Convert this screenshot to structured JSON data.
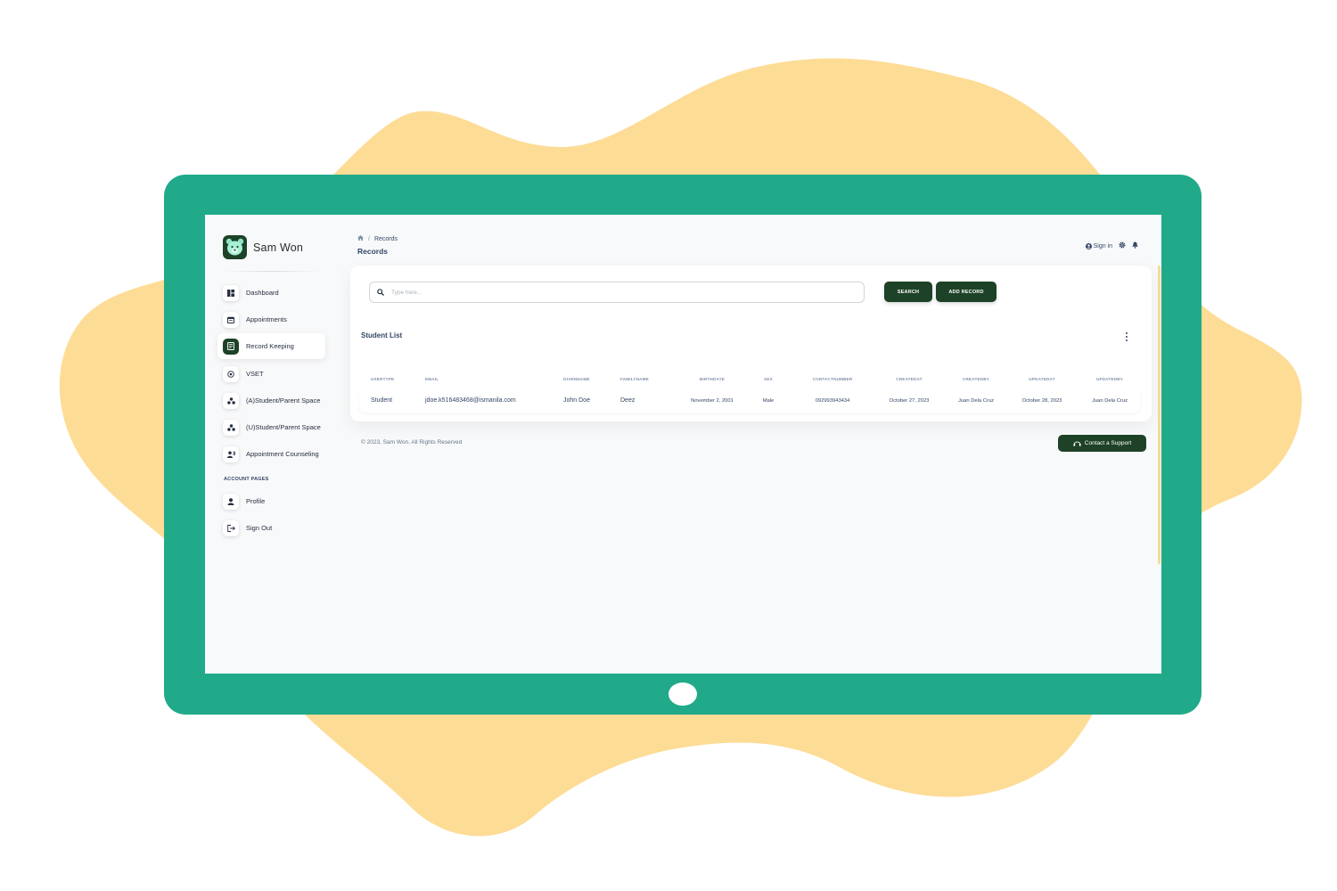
{
  "colors": {
    "frame": "#20aa89",
    "dark": "#1d4227",
    "blob": "#fddc96"
  },
  "brand": {
    "name": "Sam Won"
  },
  "sidebar": {
    "items": [
      {
        "label": "Dashboard",
        "icon": "dashboard-icon"
      },
      {
        "label": "Appointments",
        "icon": "calendar-icon"
      },
      {
        "label": "Record Keeping",
        "icon": "record-book-icon",
        "active": true
      },
      {
        "label": "VSET",
        "icon": "target-icon"
      },
      {
        "label": "(A)Student/Parent Space",
        "icon": "group-icon"
      },
      {
        "label": "(U)Student/Parent Space",
        "icon": "group-icon"
      },
      {
        "label": "Appointment Counseling",
        "icon": "counseling-icon"
      }
    ],
    "section_title": "ACCOUNT PAGES",
    "account_items": [
      {
        "label": "Profile",
        "icon": "person-icon"
      },
      {
        "label": "Sign Out",
        "icon": "sign-out-icon"
      }
    ]
  },
  "header": {
    "breadcrumb": [
      "Records"
    ],
    "title": "Records",
    "sign_in": "Sign in"
  },
  "search": {
    "placeholder": "Type here...",
    "value": ""
  },
  "buttons": {
    "search": "SEARCH",
    "add_record": "ADD RECORD"
  },
  "table": {
    "title": "Student List",
    "columns": [
      "USERTYPE",
      "EMAIL",
      "GIVENNAME",
      "FAMILYNAME",
      "BIRTHDATE",
      "SEX",
      "CONTACTNUMBER",
      "CREATEDAT",
      "CREATEDBY",
      "UPDATEDAT",
      "UPDATEDBY"
    ],
    "rows": [
      [
        "Student",
        "jdoe.k516483468@ismanila.com",
        "John Doe",
        "Deez",
        "November 2, 2001",
        "Male",
        "092993943434",
        "October 27, 2023",
        "Juan Dela Cruz",
        "October 28, 2023",
        "Juan Dela Cruz"
      ]
    ]
  },
  "footer": {
    "copyright": "© 2023, Sam Won. All Rights Reserved",
    "support": "Contact a Support"
  }
}
